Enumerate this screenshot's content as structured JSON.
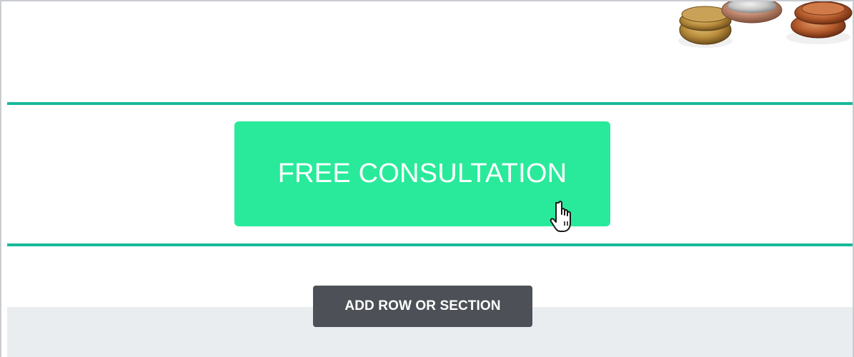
{
  "colors": {
    "row_border": "#19b99a",
    "cta_background": "#29ea9a",
    "cta_text": "#ffffff",
    "add_button_background": "#4d5157",
    "footer_background": "#e9edf0",
    "frame_border": "#c9cdd1"
  },
  "hero": {
    "image": "coins-photo"
  },
  "cta": {
    "label": "FREE CONSULTATION"
  },
  "editor": {
    "add_row_label": "ADD ROW OR SECTION"
  },
  "cursor": {
    "icon": "hand-pointer-icon"
  }
}
